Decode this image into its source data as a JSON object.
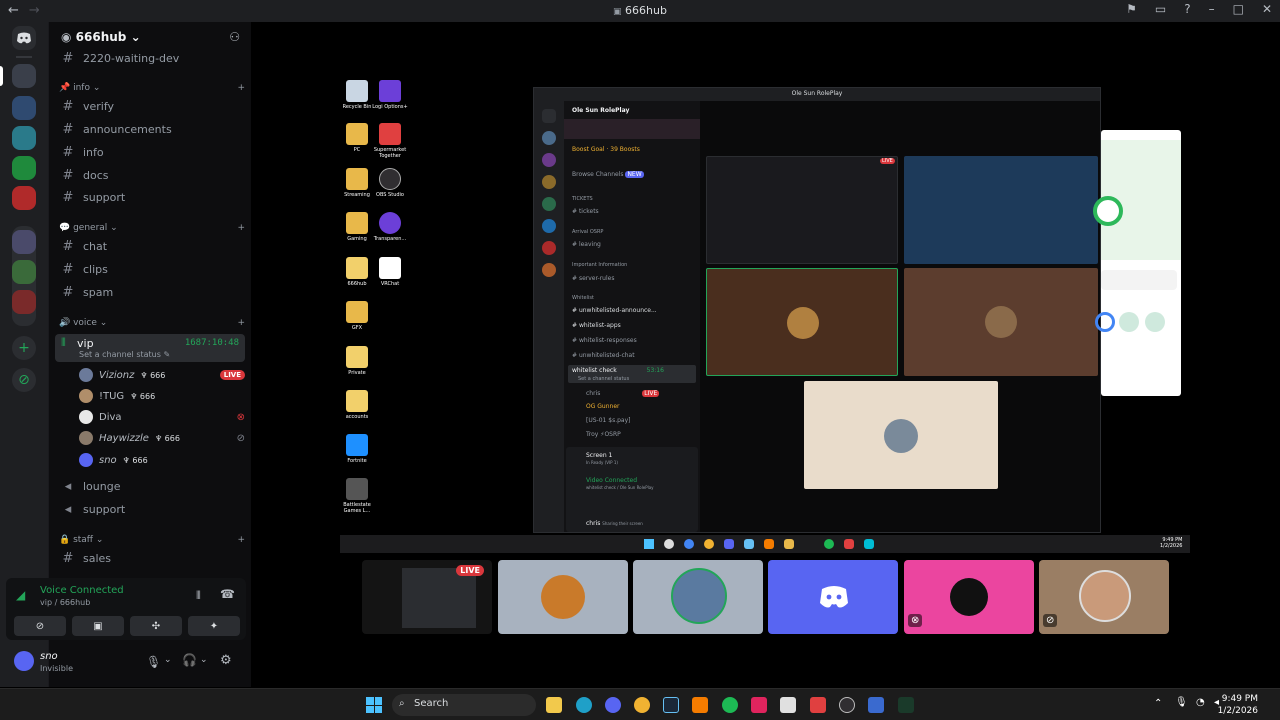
{
  "window": {
    "title": "666hub",
    "title_icon": "discord-icon",
    "controls": [
      "inbox-icon",
      "screen-icon",
      "help-icon",
      "minimize-icon",
      "maximize-icon",
      "close-icon"
    ]
  },
  "server": {
    "name": "666hub"
  },
  "channels": {
    "top": "2220-waiting-dev",
    "info_category": "info",
    "info": [
      "verify",
      "announcements",
      "info",
      "docs",
      "support"
    ],
    "general_category": "general",
    "general": [
      "chat",
      "clips",
      "spam"
    ],
    "voice_category": "voice",
    "vip": {
      "name": "vip",
      "timer": "1687:10:48",
      "status": "Set a channel status"
    },
    "members": [
      {
        "name": "Vizionz",
        "badge": "666",
        "live": "LIVE",
        "color": "#6b7a9a"
      },
      {
        "name": "!TUG",
        "badge": "666",
        "live": "",
        "color": "#b08e6a"
      },
      {
        "name": "Diva",
        "badge": "",
        "live": "",
        "color": "#e8e8e8"
      },
      {
        "name": "Haywizzle",
        "badge": "666",
        "live": "",
        "color": "#8a7a6a"
      },
      {
        "name": "sno",
        "badge": "666",
        "live": "",
        "color": "#5865f2"
      }
    ],
    "voice_after": [
      "lounge",
      "support"
    ],
    "staff_category": "staff",
    "staff": [
      "sales"
    ]
  },
  "voice_panel": {
    "status": "Voice Connected",
    "location": "vip / 666hub"
  },
  "user": {
    "name": "sno",
    "status": "Invisible"
  },
  "desktop_icons": [
    {
      "label": "Recycle Bin",
      "color": "#c9d6e3"
    },
    {
      "label": "Logi Options+",
      "color": "#6c3fd8"
    },
    {
      "label": "PC",
      "color": "#e8b84a"
    },
    {
      "label": "Supermarket Together",
      "color": "#e04040"
    },
    {
      "label": "Streaming",
      "color": "#e8b84a"
    },
    {
      "label": "OBS Studio",
      "color": "#302e31"
    },
    {
      "label": "Gaming",
      "color": "#e8b84a"
    },
    {
      "label": "Transparen...",
      "color": "#6c3fd8"
    },
    {
      "label": "666hub",
      "color": "#f2d06b"
    },
    {
      "label": "VRChat",
      "color": "#ffffff"
    },
    {
      "label": "GFX",
      "color": "#e8b84a"
    },
    {
      "label": "Private",
      "color": "#f2d06b"
    },
    {
      "label": "accounts",
      "color": "#f2d06b"
    },
    {
      "label": "Fortnite",
      "color": "#1e90ff"
    },
    {
      "label": "Battlestate Games L...",
      "color": "#555555"
    }
  ],
  "inner_window": {
    "title": "Ole Sun RolePlay",
    "server": "Ole Sun RolePlay",
    "boost": "Boost Goal",
    "boosts": "39 Boosts",
    "browse": "Browse Channels",
    "browse_badge": "NEW",
    "categories": [
      "TICKETS",
      "Arrival OSRP",
      "Important Information",
      "Whitelist"
    ],
    "channels": [
      "tickets",
      "leaving",
      "server-rules",
      "unwhitelisted-announce...",
      "whitelist-apps",
      "whitelist-responses",
      "unwhitelisted-chat"
    ],
    "voice_channel": "whitelist check",
    "voice_timer": "53:16",
    "voice_status": "Set a channel status",
    "voice_members": [
      "chris",
      "OG Gunner",
      "[US-01 $s.pay]",
      "Troy ⚡OSRP"
    ],
    "screen_share": "Screen 1",
    "screen_sub": "In Ready (VIP 1)",
    "vc_status": "Video Connected",
    "vc_location": "whitelist check / Ole Sun RolePlay",
    "user": "chris",
    "user_status": "Sharing their screen",
    "live_badge": "LIVE",
    "clock_time": "9:49 PM",
    "clock_date": "1/2/2026"
  },
  "bottom_tiles": {
    "live_badge": "LIVE"
  },
  "taskbar": {
    "search": "Search",
    "time": "9:49 PM",
    "date": "1/2/2026"
  }
}
